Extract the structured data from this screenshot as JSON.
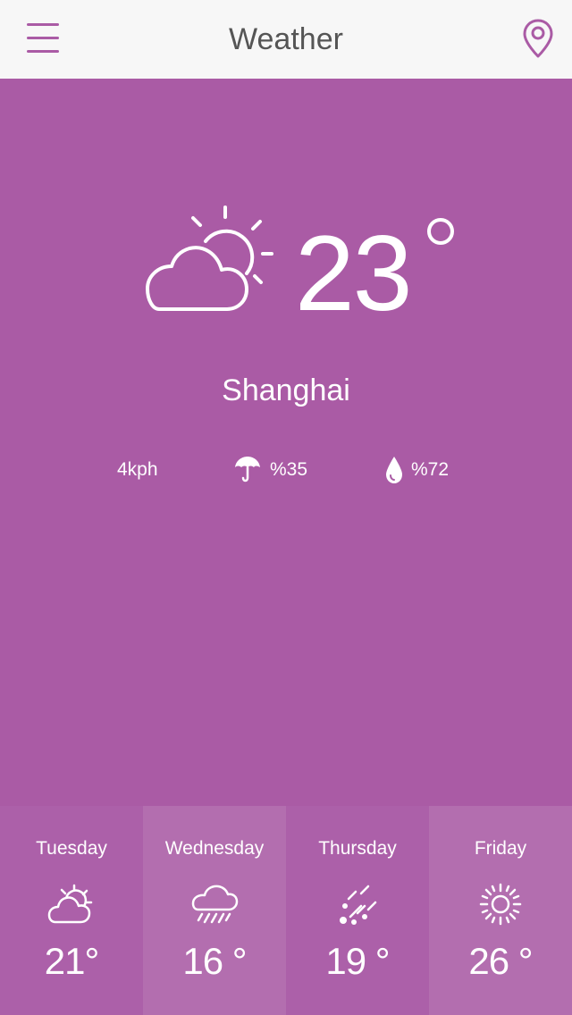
{
  "header": {
    "title": "Weather",
    "menu_icon": "hamburger-menu-icon",
    "location_icon": "map-pin-icon"
  },
  "colors": {
    "accent": "#aa5ba5",
    "header_bg": "#f7f7f7",
    "title_text": "#555555",
    "text_on_accent": "#ffffff"
  },
  "current": {
    "icon": "partly-cloudy-icon",
    "temperature": "23",
    "city": "Shanghai",
    "wind": "4kph",
    "rain_chance": "%35",
    "rain_icon": "umbrella-icon",
    "humidity": "%72",
    "humidity_icon": "water-drop-icon"
  },
  "forecast": [
    {
      "day": "Tuesday",
      "icon": "partly-cloudy-icon",
      "temp": "21°",
      "bg": "#ac60a9"
    },
    {
      "day": "Wednesday",
      "icon": "rain-cloud-icon",
      "temp": "16 °",
      "bg": "#b36eaf"
    },
    {
      "day": "Thursday",
      "icon": "hail-icon",
      "temp": "19 °",
      "bg": "#ac60a9"
    },
    {
      "day": "Friday",
      "icon": "sun-icon",
      "temp": "26 °",
      "bg": "#b36eaf"
    }
  ]
}
